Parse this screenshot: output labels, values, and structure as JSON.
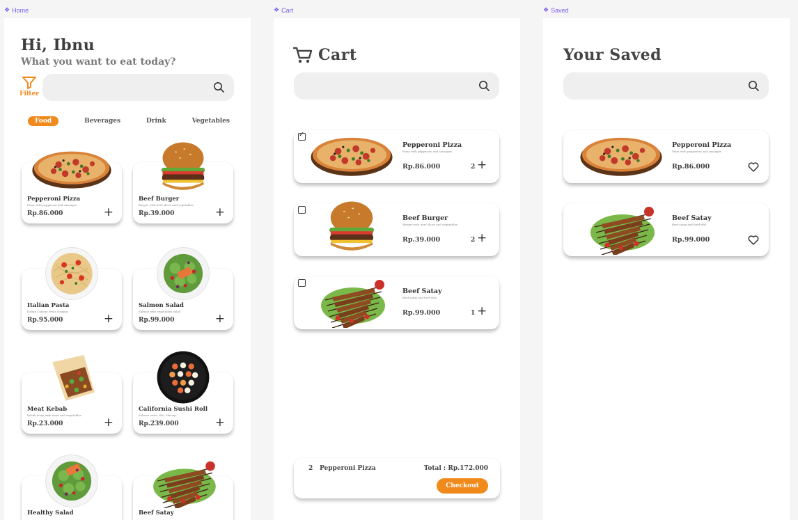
{
  "frames": {
    "home_label": "Home",
    "cart_label": "Cart",
    "saved_label": "Saved"
  },
  "colors": {
    "accent": "#f08a1c",
    "frame_label": "#7b5cf0"
  },
  "home": {
    "greeting": "Hi, Ibnu",
    "subtitle": "What you want to eat today?",
    "filter_label": "Filter",
    "categories": [
      "Food",
      "Beverages",
      "Drink",
      "Vegetables"
    ],
    "active_category": "Food",
    "products": [
      {
        "name": "Pepperoni Pizza",
        "desc": "Pizza with pepperoni and sausages",
        "price": "Rp.86.000",
        "img": "pizza"
      },
      {
        "name": "Beef Burger",
        "desc": "Burger with beef slices and vegetables",
        "price": "Rp.39.000",
        "img": "burger"
      },
      {
        "name": "Italian Pasta",
        "desc": "Italian Cuisine Pasta Organic",
        "price": "Rp.95.000",
        "img": "pasta"
      },
      {
        "name": "Salmon Salad",
        "desc": "Salmon with vegetables salad",
        "price": "Rp.99.000",
        "img": "salmon-salad"
      },
      {
        "name": "Meat Kebab",
        "desc": "Kebab wrap with meat and vegetables",
        "price": "Rp.23.000",
        "img": "kebab"
      },
      {
        "name": "California Sushi Roll",
        "desc": "Salmon sushi, Ebi, Shrimp",
        "price": "Rp.239.000",
        "img": "sushi"
      },
      {
        "name": "Healthy Salad",
        "desc": "",
        "price": "",
        "img": "healthy-salad"
      },
      {
        "name": "Beef Satay",
        "desc": "",
        "price": "",
        "img": "satay"
      }
    ]
  },
  "cart": {
    "title": "Cart",
    "items": [
      {
        "name": "Pepperoni Pizza",
        "desc": "Pizza with pepperoni and sausages",
        "price": "Rp.86.000",
        "qty": "2",
        "checked": true,
        "img": "pizza"
      },
      {
        "name": "Beef Burger",
        "desc": "Burger with beef slices and vegetables",
        "price": "Rp.39.000",
        "qty": "2",
        "checked": false,
        "img": "burger"
      },
      {
        "name": "Beef Satay",
        "desc": "Beef satay and beef ribs",
        "price": "Rp.99.000",
        "qty": "1",
        "checked": false,
        "img": "satay"
      }
    ],
    "summary": {
      "qty": "2",
      "name": "Pepperoni Pizza",
      "total": "Total : Rp.172.000",
      "checkout_label": "Checkout"
    }
  },
  "saved": {
    "title": "Your Saved",
    "items": [
      {
        "name": "Pepperoni Pizza",
        "desc": "Pizza with pepperoni and sausages",
        "price": "Rp.86.000",
        "img": "pizza"
      },
      {
        "name": "Beef Satay",
        "desc": "Beef satay and beef ribs",
        "price": "Rp.99.000",
        "img": "satay"
      }
    ]
  }
}
